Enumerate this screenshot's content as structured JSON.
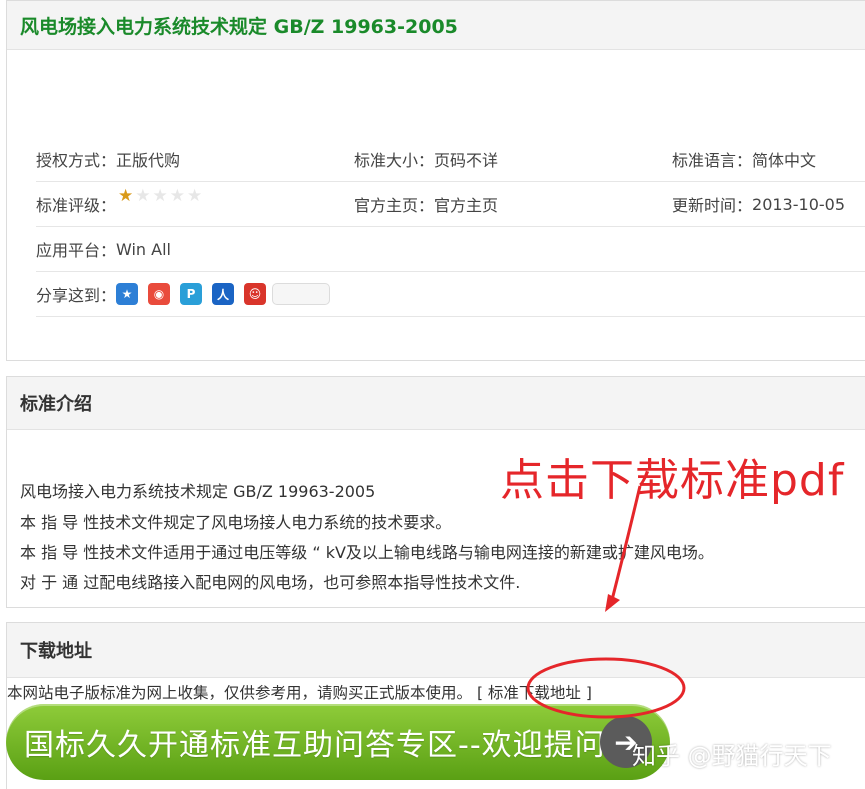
{
  "header": {
    "title": "风电场接入电力系统技术规定 GB/Z 19963-2005"
  },
  "info": {
    "rows": [
      {
        "cells": [
          {
            "label": "授权方式：",
            "value": "正版代购"
          },
          {
            "label": "标准大小：",
            "value": "页码不详"
          },
          {
            "label": "标准语言：",
            "value": "简体中文"
          }
        ]
      },
      {
        "cells": [
          {
            "label": "标准评级：",
            "value": ""
          },
          {
            "label": "官方主页：",
            "value": "官方主页"
          },
          {
            "label": "更新时间：",
            "value": "2013-10-05"
          }
        ]
      },
      {
        "cells": [
          {
            "label": "应用平台：",
            "value": "Win All"
          }
        ]
      },
      {
        "cells": [
          {
            "label": "分享这到：",
            "value": ""
          }
        ]
      }
    ],
    "rating": {
      "value": 1,
      "max": 5
    },
    "share_icons": [
      "qzone-icon",
      "weibo-icon",
      "tencent-weibo-icon",
      "renren-icon",
      "kaixin-icon"
    ]
  },
  "intro": {
    "heading": "标准介绍",
    "lines": [
      "风电场接入电力系统技术规定  GB/Z 19963-2005",
      "本 指 导 性技术文件规定了风电场接人电力系统的技术要求。",
      "本 指 导 性技术文件适用于通过电压等级 “ kV及以上输电线路与输电网连接的新建或扩建风电场。",
      "对 于 通 过配电线路接入配电网的风电场，也可参照本指导性技术文件."
    ]
  },
  "annotation": {
    "text": "点击下载标准pdf",
    "color": "#e5262a"
  },
  "download": {
    "heading": "下载地址",
    "notice": "本网站电子版标准为网上收集，仅供参考用，请购买正式版本使用。",
    "link_label": "[ 标准下载地址 ]"
  },
  "banner": {
    "label": "国标久久开通标准互助问答专区--欢迎提问"
  },
  "watermark": "知乎 @野猫行天下",
  "colors": {
    "title_green": "#1a8a2a",
    "accent_red": "#e5262a",
    "button_green": "#6fb31f"
  }
}
